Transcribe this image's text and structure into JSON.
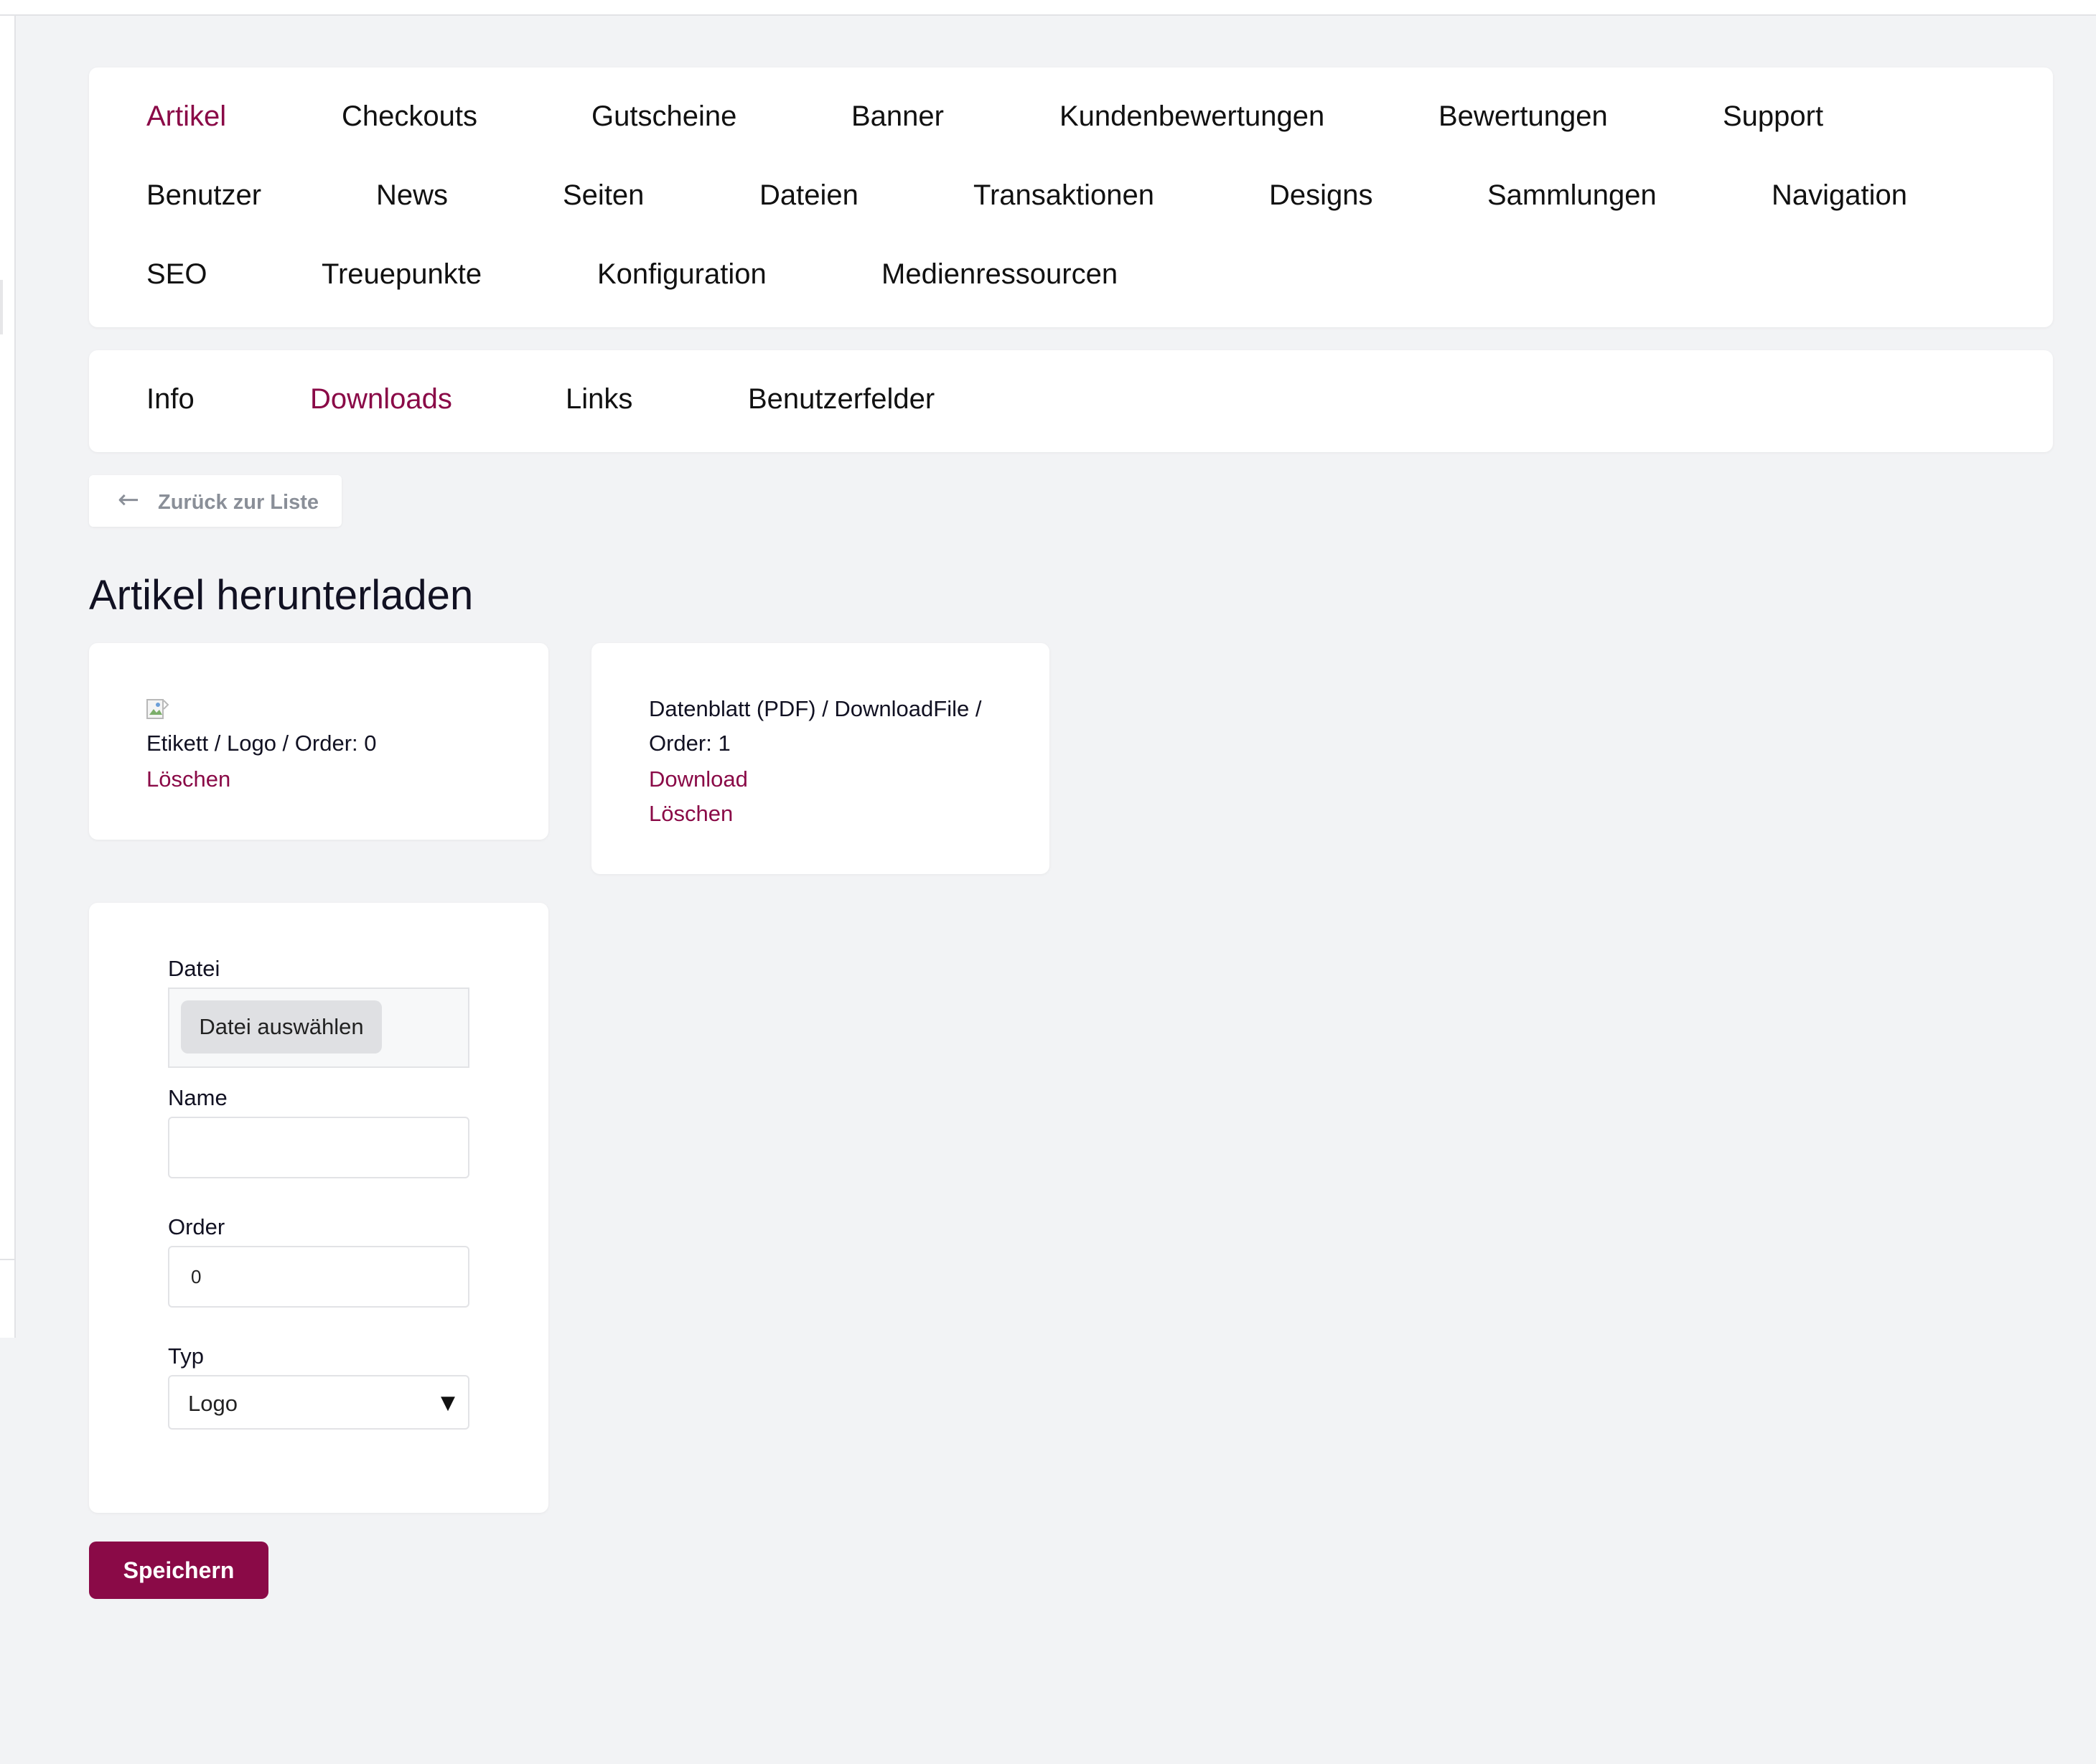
{
  "main_nav": {
    "row1": [
      "Artikel",
      "Checkouts",
      "Gutscheine",
      "Banner",
      "Kundenbewertungen",
      "Bewertungen",
      "Support"
    ],
    "row2": [
      "Benutzer",
      "News",
      "Seiten",
      "Dateien",
      "Transaktionen",
      "Designs",
      "Sammlungen",
      "Navigation"
    ],
    "row3": [
      "SEO",
      "Treuepunkte",
      "Konfiguration",
      "Medienressourcen"
    ],
    "active": "Artikel"
  },
  "sub_nav": {
    "items": [
      "Info",
      "Downloads",
      "Links",
      "Benutzerfelder"
    ],
    "active": "Downloads"
  },
  "back_button": {
    "label": "Zurück zur Liste",
    "icon": "arrow-left-icon"
  },
  "page_title": "Artikel herunterladen",
  "downloads": [
    {
      "info": "Etikett / Logo / Order: 0",
      "delete_label": "Löschen",
      "has_image": true
    },
    {
      "info_line1": "Datenblatt (PDF) / DownloadFile /",
      "info_line2": "Order: 1",
      "download_label": "Download",
      "delete_label": "Löschen"
    }
  ],
  "form": {
    "file_label": "Datei",
    "file_button": "Datei auswählen",
    "name_label": "Name",
    "name_value": "",
    "order_label": "Order",
    "order_value": "0",
    "type_label": "Typ",
    "type_value": "Logo"
  },
  "save_button": "Speichern",
  "colors": {
    "accent": "#8a0a47",
    "background": "#f2f3f5"
  }
}
